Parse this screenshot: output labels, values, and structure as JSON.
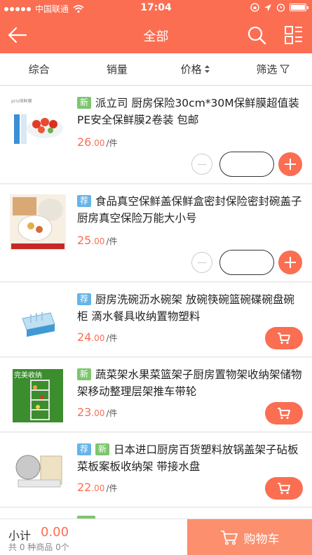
{
  "status": {
    "carrier": "中国联通",
    "time": "17:04"
  },
  "nav": {
    "title": "全部"
  },
  "sort": {
    "zonghe": "综合",
    "xiaoliang": "销量",
    "jiage": "价格",
    "shaixuan": "筛选"
  },
  "items": [
    {
      "tags": [
        "新"
      ],
      "title": "派立司 厨房保险30cm*30M保鲜膜超值装PE安全保鲜膜2卷装 包邮",
      "price_int": "26",
      "price_dec": ".00",
      "unit": "/件",
      "control": "stepper"
    },
    {
      "tags": [
        "荐"
      ],
      "title": "食品真空保鲜盖保鲜盒密封保险密封碗盖子厨房真空保险万能大小号",
      "price_int": "25",
      "price_dec": ".00",
      "unit": "/件",
      "control": "stepper"
    },
    {
      "tags": [
        "荐"
      ],
      "title": "厨房洗碗沥水碗架 放碗筷碗篮碗碟碗盘碗柜 滴水餐具收纳置物塑料",
      "price_int": "24",
      "price_dec": ".00",
      "unit": "/件",
      "control": "cart"
    },
    {
      "tags": [
        "新"
      ],
      "title": "蔬菜架水果菜篮架子厨房置物架收纳架储物架移动整理层架推车带轮",
      "price_int": "23",
      "price_dec": ".00",
      "unit": "/件",
      "control": "cart",
      "thumb_text": "完美收纳"
    },
    {
      "tags": [
        "荐",
        "新"
      ],
      "title": "日本进口厨房百货塑料放锅盖架子砧板菜板案板收纳架 带接水盘",
      "price_int": "22",
      "price_dec": ".00",
      "unit": "/件",
      "control": "cart"
    }
  ],
  "footer": {
    "subtotal_label": "小计",
    "subtotal_value": "0.00",
    "note": "共 0 种商品 0个",
    "cart_label": "购物车"
  },
  "colors": {
    "accent": "#fb6e52",
    "tag_new": "#7cc66e",
    "tag_rec": "#66b4e8"
  }
}
